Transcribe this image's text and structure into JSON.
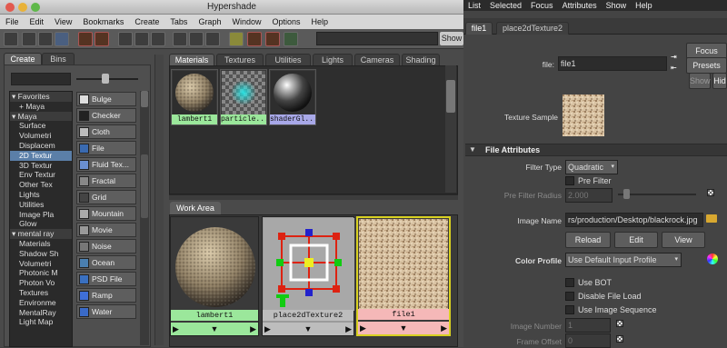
{
  "hypershade": {
    "title": "Hypershade",
    "menu": [
      "File",
      "Edit",
      "View",
      "Bookmarks",
      "Create",
      "Tabs",
      "Graph",
      "Window",
      "Options",
      "Help"
    ],
    "show_label": "Show",
    "left_tabs": [
      "Create",
      "Bins"
    ],
    "tree": [
      {
        "label": "Favorites",
        "type": "hd"
      },
      {
        "label": "+ Maya",
        "type": "item"
      },
      {
        "label": "Maya",
        "type": "hd"
      },
      {
        "label": "Surface",
        "type": "item"
      },
      {
        "label": "Volumetri",
        "type": "item"
      },
      {
        "label": "Displacem",
        "type": "item"
      },
      {
        "label": "2D Textur",
        "type": "sel"
      },
      {
        "label": "3D Textur",
        "type": "item"
      },
      {
        "label": "Env Textur",
        "type": "item"
      },
      {
        "label": "Other Tex",
        "type": "item"
      },
      {
        "label": "Lights",
        "type": "item"
      },
      {
        "label": "Utilities",
        "type": "item"
      },
      {
        "label": "Image Pla",
        "type": "item"
      },
      {
        "label": "Glow",
        "type": "item"
      },
      {
        "label": "mental ray",
        "type": "hd"
      },
      {
        "label": "Materials",
        "type": "item"
      },
      {
        "label": "Shadow Sh",
        "type": "item"
      },
      {
        "label": "Volumetri",
        "type": "item"
      },
      {
        "label": "Photonic M",
        "type": "item"
      },
      {
        "label": "Photon Vo",
        "type": "item"
      },
      {
        "label": "Textures",
        "type": "item"
      },
      {
        "label": "Environme",
        "type": "item"
      },
      {
        "label": "MentalRay",
        "type": "item"
      },
      {
        "label": "Light Map",
        "type": "item"
      }
    ],
    "nodes": [
      {
        "label": "Bulge",
        "color": "#ddd"
      },
      {
        "label": "Checker",
        "color": "#222"
      },
      {
        "label": "Cloth",
        "color": "#bbb"
      },
      {
        "label": "File",
        "color": "#3a6ab0"
      },
      {
        "label": "Fluid Tex...",
        "color": "#6a8fd0"
      },
      {
        "label": "Fractal",
        "color": "#888"
      },
      {
        "label": "Grid",
        "color": "#444"
      },
      {
        "label": "Mountain",
        "color": "#aaa"
      },
      {
        "label": "Movie",
        "color": "#999"
      },
      {
        "label": "Noise",
        "color": "#777"
      },
      {
        "label": "Ocean",
        "color": "#4a7fb0"
      },
      {
        "label": "PSD File",
        "color": "#3a70c0"
      },
      {
        "label": "Ramp",
        "color": "#3f6fd8"
      },
      {
        "label": "Water",
        "color": "#3a6ac8"
      }
    ],
    "browser_tabs": [
      "Materials",
      "Textures",
      "Utilities",
      "Lights",
      "Cameras",
      "Shading"
    ],
    "swatches": [
      {
        "label": "lambert1",
        "color": "#9be79b"
      },
      {
        "label": "particle...",
        "color": "#9be79b"
      },
      {
        "label": "shaderGl...",
        "color": "#a8a8e8"
      }
    ],
    "work_area_tab": "Work Area",
    "work_nodes": [
      {
        "label": "lambert1",
        "color": "#9be79b"
      },
      {
        "label": "place2dTexture2",
        "color": "#bdbdbd"
      },
      {
        "label": "file1",
        "color": "#f5b8b8"
      }
    ]
  },
  "attribute_editor": {
    "menu": [
      "List",
      "Selected",
      "Focus",
      "Attributes",
      "Show",
      "Help"
    ],
    "tabs": [
      "file1",
      "place2dTexture2"
    ],
    "file_label": "file:",
    "file_value": "file1",
    "focus_label": "Focus",
    "presets_label": "Presets",
    "show_label": "Show",
    "hide_label": "Hid",
    "texture_sample_label": "Texture Sample",
    "section_title": "File Attributes",
    "filter_type_label": "Filter Type",
    "filter_type_value": "Quadratic",
    "pre_filter_label": "Pre Filter",
    "pre_filter_radius_label": "Pre Filter Radius",
    "pre_filter_radius_value": "2.000",
    "image_name_label": "Image Name",
    "image_name_value": "rs/production/Desktop/blackrock.jpg",
    "reload_label": "Reload",
    "edit_label": "Edit",
    "view_label": "View",
    "color_profile_label": "Color Profile",
    "color_profile_value": "Use Default Input Profile",
    "use_bot_label": "Use BOT",
    "disable_file_load_label": "Disable File Load",
    "use_image_sequence_label": "Use Image Sequence",
    "image_number_label": "Image Number",
    "image_number_value": "1",
    "frame_offset_label": "Frame Offset",
    "frame_offset_value": "0"
  }
}
